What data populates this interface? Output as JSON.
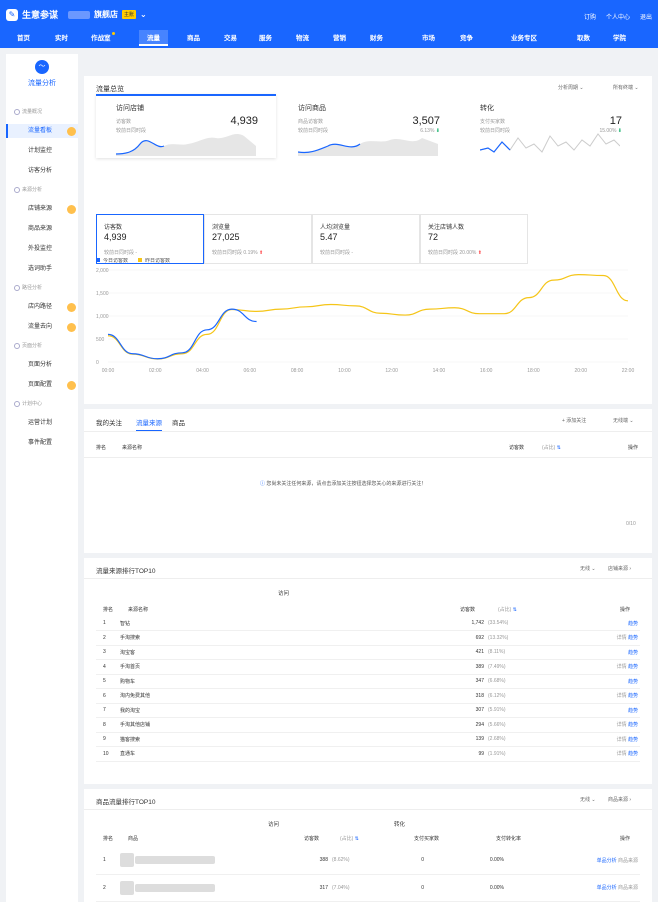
{
  "app": {
    "name": "生意参谋",
    "shop_suffix": "旗舰店",
    "badge": "主账"
  },
  "toplinks": [
    "订购",
    "个人中心",
    "退出"
  ],
  "nav": [
    "首页",
    "实时",
    "作战室",
    "流量",
    "商品",
    "交易",
    "服务",
    "物流",
    "营销",
    "财务",
    "市场",
    "竞争",
    "业务专区",
    "取数",
    "学院"
  ],
  "sidebar": {
    "title": "流量分析",
    "groups": [
      "流量概况",
      "来源分析",
      "路径分析",
      "页面分析",
      "计划中心"
    ],
    "items": [
      "流量看板",
      "计划监控",
      "访客分析",
      "店铺来源",
      "商品来源",
      "外投监控",
      "选词助手",
      "店内路径",
      "流量去向",
      "页面分析",
      "页面配置",
      "运营计划",
      "事件配置"
    ]
  },
  "overview": {
    "title": "流量总览",
    "filter1": "分析周期",
    "filter2": "所有终端",
    "cards": [
      {
        "title": "访问店铺",
        "label1": "访客数",
        "label2": "较前日同时段",
        "value": "4,939",
        "pct": ""
      },
      {
        "title": "访问商品",
        "label1": "商品访客数",
        "label2": "较前日同时段",
        "value": "3,507",
        "pct": "6.13%"
      },
      {
        "title": "转化",
        "label1": "支付买家数",
        "label2": "较前日同时段",
        "value": "17",
        "pct": "15.00%"
      }
    ]
  },
  "metrics": [
    {
      "label": "访客数",
      "value": "4,939",
      "cmp": "较前日同时段",
      "pct": "-"
    },
    {
      "label": "浏览量",
      "value": "27,025",
      "cmp": "较前日同时段",
      "pct": "0.19%"
    },
    {
      "label": "人均浏览量",
      "value": "5.47",
      "cmp": "较前日同时段",
      "pct": "-"
    },
    {
      "label": "关注店铺人数",
      "value": "72",
      "cmp": "较前日同时段",
      "pct": "20.00%"
    }
  ],
  "chart_data": {
    "type": "line",
    "x": [
      "00:00",
      "02:00",
      "04:00",
      "06:00",
      "08:00",
      "10:00",
      "12:00",
      "14:00",
      "16:00",
      "18:00",
      "20:00",
      "22:00"
    ],
    "ylim": [
      0,
      2000
    ],
    "yticks": [
      "0",
      "500",
      "1,000",
      "1,500",
      "2,000"
    ],
    "series": [
      {
        "name": "今日访客数",
        "color": "#1966ff",
        "values": [
          600,
          180,
          70,
          200,
          700,
          1150,
          880
        ]
      },
      {
        "name": "昨日访客数",
        "color": "#f5c518",
        "values": [
          570,
          170,
          65,
          180,
          600,
          1140,
          1100,
          1150,
          1200,
          1250,
          1220,
          1060,
          1020,
          1150,
          1180,
          1050,
          1050,
          1400,
          1780,
          1900,
          1880,
          1330
        ]
      }
    ],
    "xlabel": "",
    "ylabel": ""
  },
  "focus": {
    "title": "我的关注",
    "tabs": [
      "流量来源",
      "商品"
    ],
    "add": "+ 添加关注",
    "filter": "无线端",
    "cols": [
      "排名",
      "来源名称",
      "访客数",
      "(占比)",
      "操作"
    ],
    "empty": "您尚未关注任何来源，请点击添加关注按钮选择您关心的来源进行关注！",
    "page": "0/10"
  },
  "top10": {
    "title": "流量来源排行TOP10",
    "f1": "无线",
    "f2": "店铺来源",
    "group": "访问",
    "cols": [
      "排名",
      "来源名称",
      "访客数",
      "(占比)",
      "操作"
    ],
    "rows": [
      [
        "1",
        "智钻",
        "1,742",
        "(33.54%)",
        "",
        "趋势"
      ],
      [
        "2",
        "手淘搜索",
        "692",
        "(13.32%)",
        "详情",
        "趋势"
      ],
      [
        "3",
        "淘宝客",
        "421",
        "(8.11%)",
        "",
        "趋势"
      ],
      [
        "4",
        "手淘首页",
        "389",
        "(7.49%)",
        "详情",
        "趋势"
      ],
      [
        "5",
        "购物车",
        "347",
        "(6.68%)",
        "",
        "趋势"
      ],
      [
        "6",
        "淘内免费其他",
        "318",
        "(6.12%)",
        "详情",
        "趋势"
      ],
      [
        "7",
        "我的淘宝",
        "307",
        "(5.91%)",
        "",
        "趋势"
      ],
      [
        "8",
        "手淘其他店铺",
        "294",
        "(5.66%)",
        "详情",
        "趋势"
      ],
      [
        "9",
        "猫客搜索",
        "139",
        "(2.68%)",
        "详情",
        "趋势"
      ],
      [
        "10",
        "直通车",
        "99",
        "(1.91%)",
        "详情",
        "趋势"
      ]
    ]
  },
  "goods": {
    "title": "商品流量排行TOP10",
    "f1": "无线",
    "f2": "商品来源",
    "g1": "访问",
    "g2": "转化",
    "cols": [
      "排名",
      "商品",
      "访客数",
      "(占比)",
      "支付买家数",
      "支付转化率",
      "操作"
    ],
    "rows": [
      [
        "1",
        "388",
        "(8.62%)",
        "0",
        "0.00%",
        "单品分析",
        "商品来源"
      ],
      [
        "2",
        "317",
        "(7.04%)",
        "0",
        "0.00%",
        "单品分析",
        "商品来源"
      ]
    ]
  }
}
